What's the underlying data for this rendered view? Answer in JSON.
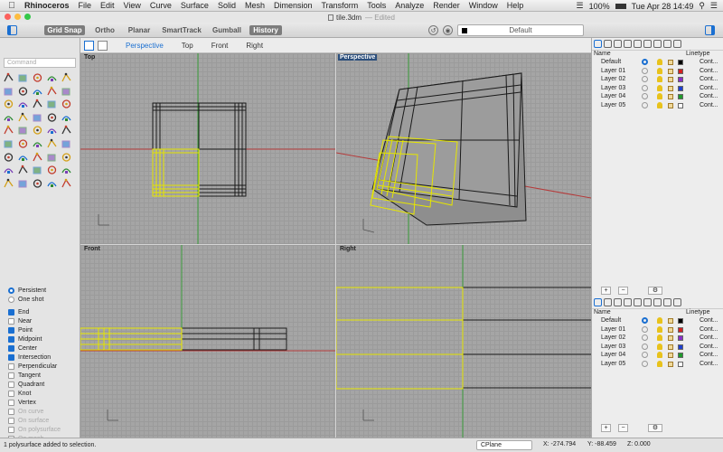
{
  "menubar": {
    "app": "Rhinoceros",
    "items": [
      "File",
      "Edit",
      "View",
      "Curve",
      "Surface",
      "Solid",
      "Mesh",
      "Dimension",
      "Transform",
      "Tools",
      "Analyze",
      "Render",
      "Window",
      "Help"
    ],
    "battery": "100%",
    "clock": "Tue Apr 28  14:49"
  },
  "window": {
    "title": "tile.3dm",
    "status": "— Edited"
  },
  "toolbar": {
    "toggles": [
      {
        "label": "Grid Snap",
        "on": true
      },
      {
        "label": "Ortho",
        "on": false
      },
      {
        "label": "Planar",
        "on": false
      },
      {
        "label": "SmartTrack",
        "on": false
      },
      {
        "label": "Gumball",
        "on": false
      },
      {
        "label": "History",
        "on": true
      }
    ],
    "layer": "Default"
  },
  "viewport_tabs": [
    "Perspective",
    "Top",
    "Front",
    "Right"
  ],
  "command_placeholder": "Command",
  "viewports": {
    "top": "Top",
    "perspective": "Perspective",
    "front": "Front",
    "right": "Right"
  },
  "osnap": {
    "mode": [
      {
        "label": "Persistent",
        "selected": true
      },
      {
        "label": "One shot",
        "selected": false
      }
    ],
    "snaps": [
      {
        "label": "End",
        "checked": true,
        "enabled": true
      },
      {
        "label": "Near",
        "checked": false,
        "enabled": true
      },
      {
        "label": "Point",
        "checked": true,
        "enabled": true
      },
      {
        "label": "Midpoint",
        "checked": true,
        "enabled": true
      },
      {
        "label": "Center",
        "checked": true,
        "enabled": true
      },
      {
        "label": "Intersection",
        "checked": true,
        "enabled": true
      },
      {
        "label": "Perpendicular",
        "checked": false,
        "enabled": true
      },
      {
        "label": "Tangent",
        "checked": false,
        "enabled": true
      },
      {
        "label": "Quadrant",
        "checked": false,
        "enabled": true
      },
      {
        "label": "Knot",
        "checked": false,
        "enabled": true
      },
      {
        "label": "Vertex",
        "checked": false,
        "enabled": true
      },
      {
        "label": "On curve",
        "checked": false,
        "enabled": false
      },
      {
        "label": "On surface",
        "checked": false,
        "enabled": false
      },
      {
        "label": "On polysurface",
        "checked": false,
        "enabled": false
      },
      {
        "label": "On mesh",
        "checked": false,
        "enabled": false
      }
    ]
  },
  "layers": {
    "headers": {
      "name": "Name",
      "linetype": "Linetype"
    },
    "linetype_value": "Cont...",
    "items": [
      {
        "name": "Default",
        "current": true,
        "color": "#000000"
      },
      {
        "name": "Layer 01",
        "current": false,
        "color": "#d42020"
      },
      {
        "name": "Layer 02",
        "current": false,
        "color": "#8a2fc9"
      },
      {
        "name": "Layer 03",
        "current": false,
        "color": "#1e3fd0"
      },
      {
        "name": "Layer 04",
        "current": false,
        "color": "#1f9a2b"
      },
      {
        "name": "Layer 05",
        "current": false,
        "color": "#ffffff"
      }
    ]
  },
  "status": {
    "message": "1 polysurface added to selection.",
    "cplane": "CPlane",
    "x": "X: -274.794",
    "y": "Y: -88.459",
    "z": "Z: 0.000"
  }
}
